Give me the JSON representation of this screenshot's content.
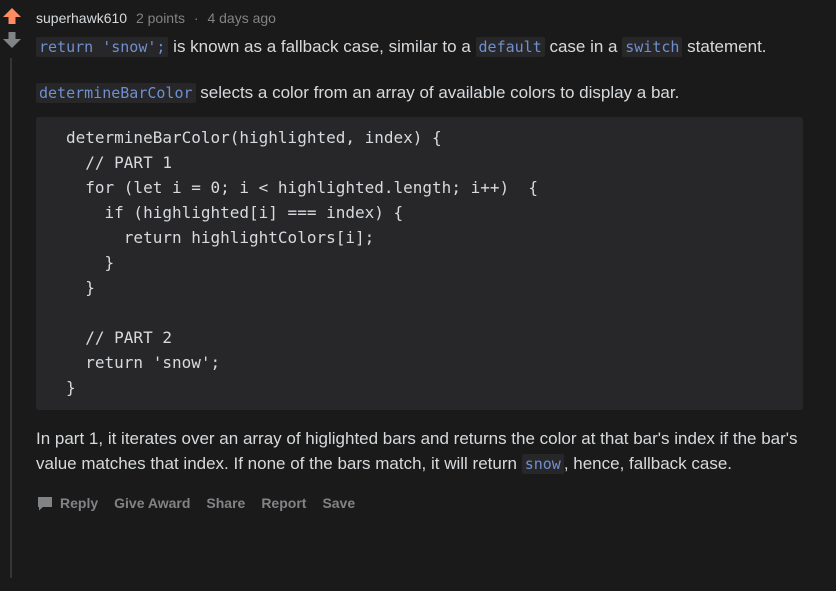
{
  "comment": {
    "author": "superhawk610",
    "points": "2 points",
    "separator": "·",
    "time": "4 days ago",
    "paragraph1": {
      "code1": "return 'snow';",
      "text1": " is known as a fallback case, similar to a ",
      "code2": "default",
      "text2": " case in a ",
      "code3": "switch",
      "text3": " statement."
    },
    "paragraph2": {
      "code1": "determineBarColor",
      "text1": " selects a color from an array of available colors to display a bar."
    },
    "code_block": "determineBarColor(highlighted, index) {\n  // PART 1\n  for (let i = 0; i < highlighted.length; i++)  {\n    if (highlighted[i] === index) {\n      return highlightColors[i];\n    }\n  }\n\n  // PART 2\n  return 'snow';\n}",
    "paragraph3": {
      "text1": "In part 1, it iterates over an array of higlighted bars and returns the color at that bar's index if the bar's value matches that index. If none of the bars match, it will return ",
      "code1": "snow",
      "text2": ", hence, fallback case."
    },
    "actions": {
      "reply": "Reply",
      "give_award": "Give Award",
      "share": "Share",
      "report": "Report",
      "save": "Save"
    },
    "colors": {
      "upvote": "#ff8b60",
      "downvote": "#818384",
      "inline_code": "#6f8fcf"
    },
    "icons": {
      "upvote": "upvote-arrow-icon",
      "downvote": "downvote-arrow-icon",
      "reply": "speech-bubble-icon"
    }
  }
}
